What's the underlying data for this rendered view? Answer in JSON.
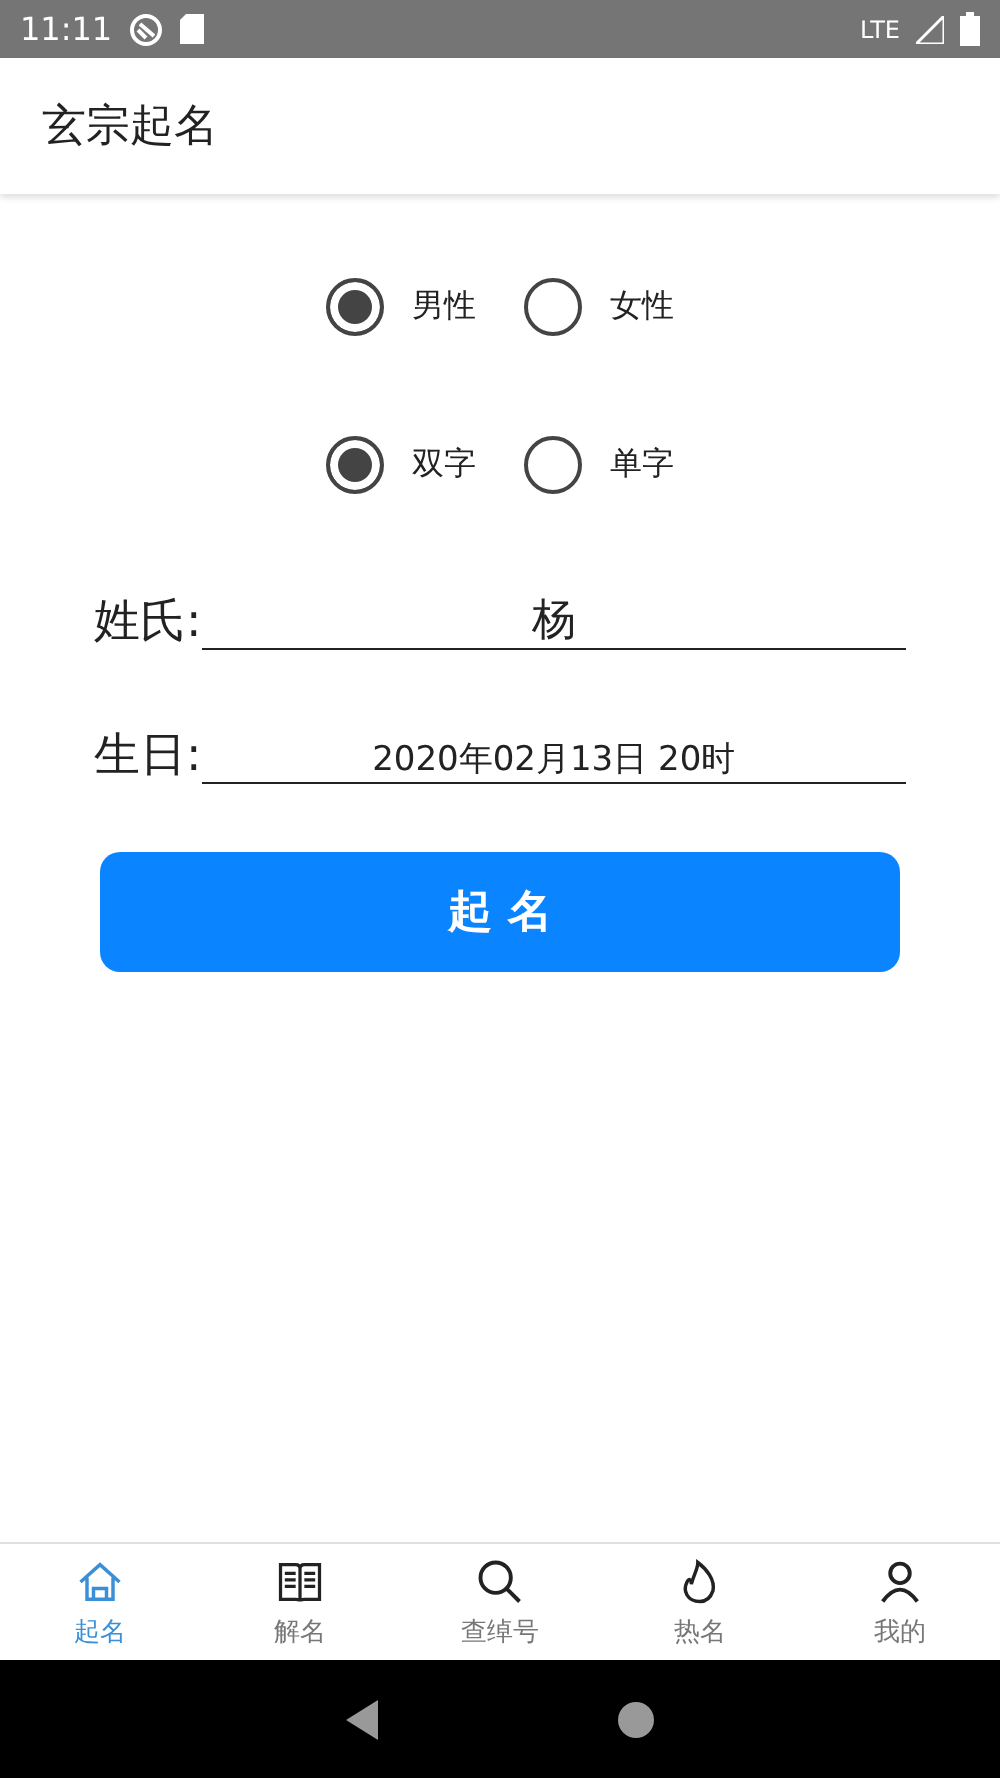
{
  "status_bar": {
    "time": "11:11",
    "network": "LTE"
  },
  "app_bar": {
    "title": "玄宗起名"
  },
  "gender_options": [
    {
      "label": "男性",
      "selected": true
    },
    {
      "label": "女性",
      "selected": false
    }
  ],
  "length_options": [
    {
      "label": "双字",
      "selected": true
    },
    {
      "label": "单字",
      "selected": false
    }
  ],
  "fields": [
    {
      "label": "姓氏:",
      "value": "杨",
      "kind": "large"
    },
    {
      "label": "生日:",
      "value": "2020年02月13日 20时",
      "kind": "small"
    }
  ],
  "submit_button": "起 名",
  "bottom_nav": [
    {
      "label": "起名",
      "kind": "home",
      "selected": true
    },
    {
      "label": "解名",
      "kind": "book",
      "selected": false
    },
    {
      "label": "查绰号",
      "kind": "search",
      "selected": false
    },
    {
      "label": "热名",
      "kind": "flame",
      "selected": false
    },
    {
      "label": "我的",
      "kind": "person",
      "selected": false
    }
  ]
}
